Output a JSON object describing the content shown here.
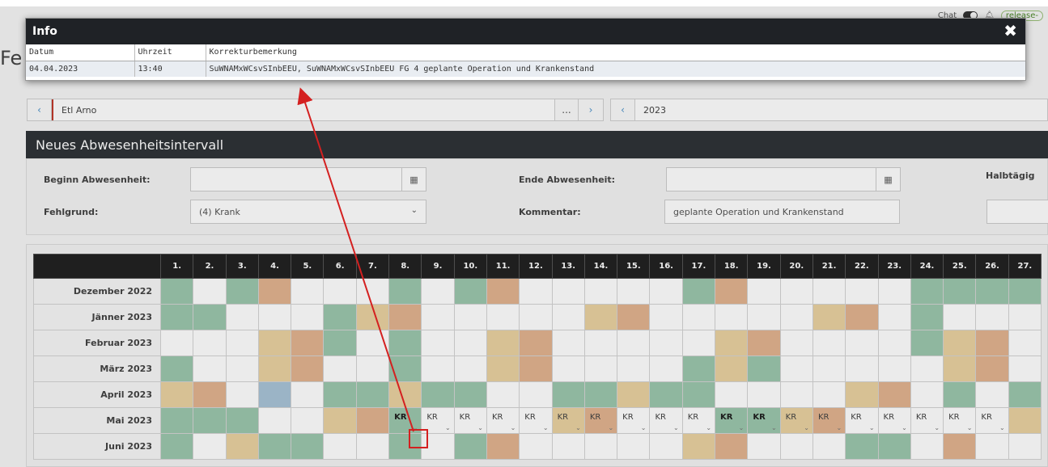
{
  "topbar": {
    "chat_label": "Chat",
    "release_label": "release-"
  },
  "page": {
    "title_fragment": "Fe"
  },
  "modal": {
    "title": "Info",
    "close_symbol": "✖",
    "columns": [
      "Datum",
      "Uhrzeit",
      "Korrekturbemerkung"
    ],
    "row": [
      "04.04.2023",
      "13:40",
      "SuWNAMxWCsvSInbEEU, SuWNAMxWCsvSInbEEU FG 4 geplante Operation und Krankenstand"
    ]
  },
  "nav": {
    "person_name": "Etl Arno",
    "dots": "...",
    "prev": "‹",
    "next": "›",
    "year": "2023"
  },
  "section": {
    "title": "Neues Abwesenheitsintervall"
  },
  "form": {
    "begin_label": "Beginn Abwesenheit:",
    "begin_value": "",
    "end_label": "Ende Abwesenheit:",
    "end_value": "",
    "halbtag_label": "Halbtägig",
    "reason_label": "Fehlgrund:",
    "reason_value": "(4) Krank",
    "comment_label": "Kommentar:",
    "comment_value": "geplante Operation und Krankenstand"
  },
  "grid": {
    "days": [
      "1.",
      "2.",
      "3.",
      "4.",
      "5.",
      "6.",
      "7.",
      "8.",
      "9.",
      "10.",
      "11.",
      "12.",
      "13.",
      "14.",
      "15.",
      "16.",
      "17.",
      "18.",
      "19.",
      "20.",
      "21.",
      "22.",
      "23.",
      "24.",
      "25.",
      "26.",
      "27."
    ],
    "months": [
      "Dezember 2022",
      "Jänner 2023",
      "Februar 2023",
      "März 2023",
      "April 2023",
      "Mai 2023",
      "Juni 2023"
    ],
    "kr_label": "KR",
    "colors": {
      "green": "#9cc7ad",
      "orange": "#e2b490",
      "yellow": "#ead2a1",
      "blue": "#a9c4d7",
      "header": "#222222"
    }
  }
}
